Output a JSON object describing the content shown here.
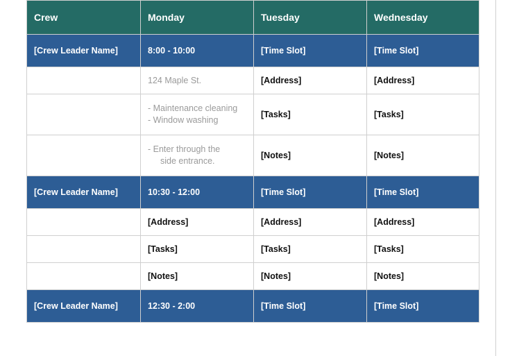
{
  "header": {
    "crew": "Crew",
    "monday": "Monday",
    "tuesday": "Tuesday",
    "wednesday": "Wednesday"
  },
  "slots": [
    {
      "leader": "[Crew Leader Name]",
      "monday": {
        "time": "8:00 - 10:00",
        "address": "124 Maple St.",
        "task1": "- Maintenance cleaning",
        "task2": "- Window washing",
        "note1": "- Enter through the",
        "note2": "side entrance."
      },
      "tuesday": {
        "time": "[Time Slot]",
        "address": "[Address]",
        "tasks": "[Tasks]",
        "notes": "[Notes]"
      },
      "wednesday": {
        "time": "[Time Slot]",
        "address": "[Address]",
        "tasks": "[Tasks]",
        "notes": "[Notes]"
      }
    },
    {
      "leader": "[Crew Leader Name]",
      "monday": {
        "time": "10:30 - 12:00",
        "address": "[Address]",
        "tasks": "[Tasks]",
        "notes": "[Notes]"
      },
      "tuesday": {
        "time": "[Time Slot]",
        "address": "[Address]",
        "tasks": "[Tasks]",
        "notes": "[Notes]"
      },
      "wednesday": {
        "time": "[Time Slot]",
        "address": "[Address]",
        "tasks": "[Tasks]",
        "notes": "[Notes]"
      }
    },
    {
      "leader": "[Crew Leader Name]",
      "monday": {
        "time": "12:30 - 2:00"
      },
      "tuesday": {
        "time": "[Time Slot]"
      },
      "wednesday": {
        "time": "[Time Slot]"
      }
    }
  ]
}
